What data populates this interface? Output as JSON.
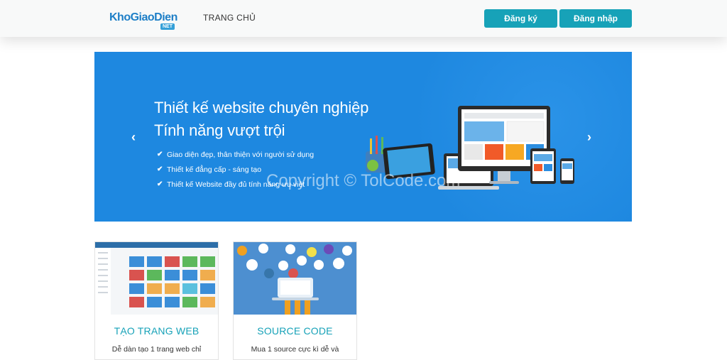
{
  "header": {
    "logo_text": "KhoGiaoDien",
    "logo_suffix": "NET",
    "nav_home": "TRANG CHỦ",
    "register_label": "Đăng ký",
    "login_label": "Đăng nhập",
    "accent_color": "#17a2b8"
  },
  "banner": {
    "headline_1": "Thiết kế website chuyên nghiệp",
    "headline_2": "Tính năng vượt trội",
    "features": [
      "Giao diện đẹp, thân thiện với người sử dụng",
      "Thiết kế đẳng cấp - sáng tạo",
      "Thiết kế Website đầy đủ tính năng ưu việt"
    ],
    "check_glyph": "✔",
    "prev_glyph": "‹",
    "next_glyph": "›",
    "watermark": "Copyright © TolCode.com",
    "background_color": "#1e88e0"
  },
  "cards": [
    {
      "title": "TẠO TRANG WEB",
      "desc": "Dễ dàn tạo 1 trang web chỉ"
    },
    {
      "title": "SOURCE CODE",
      "desc": "Mua 1 source cực kì dễ và"
    }
  ]
}
